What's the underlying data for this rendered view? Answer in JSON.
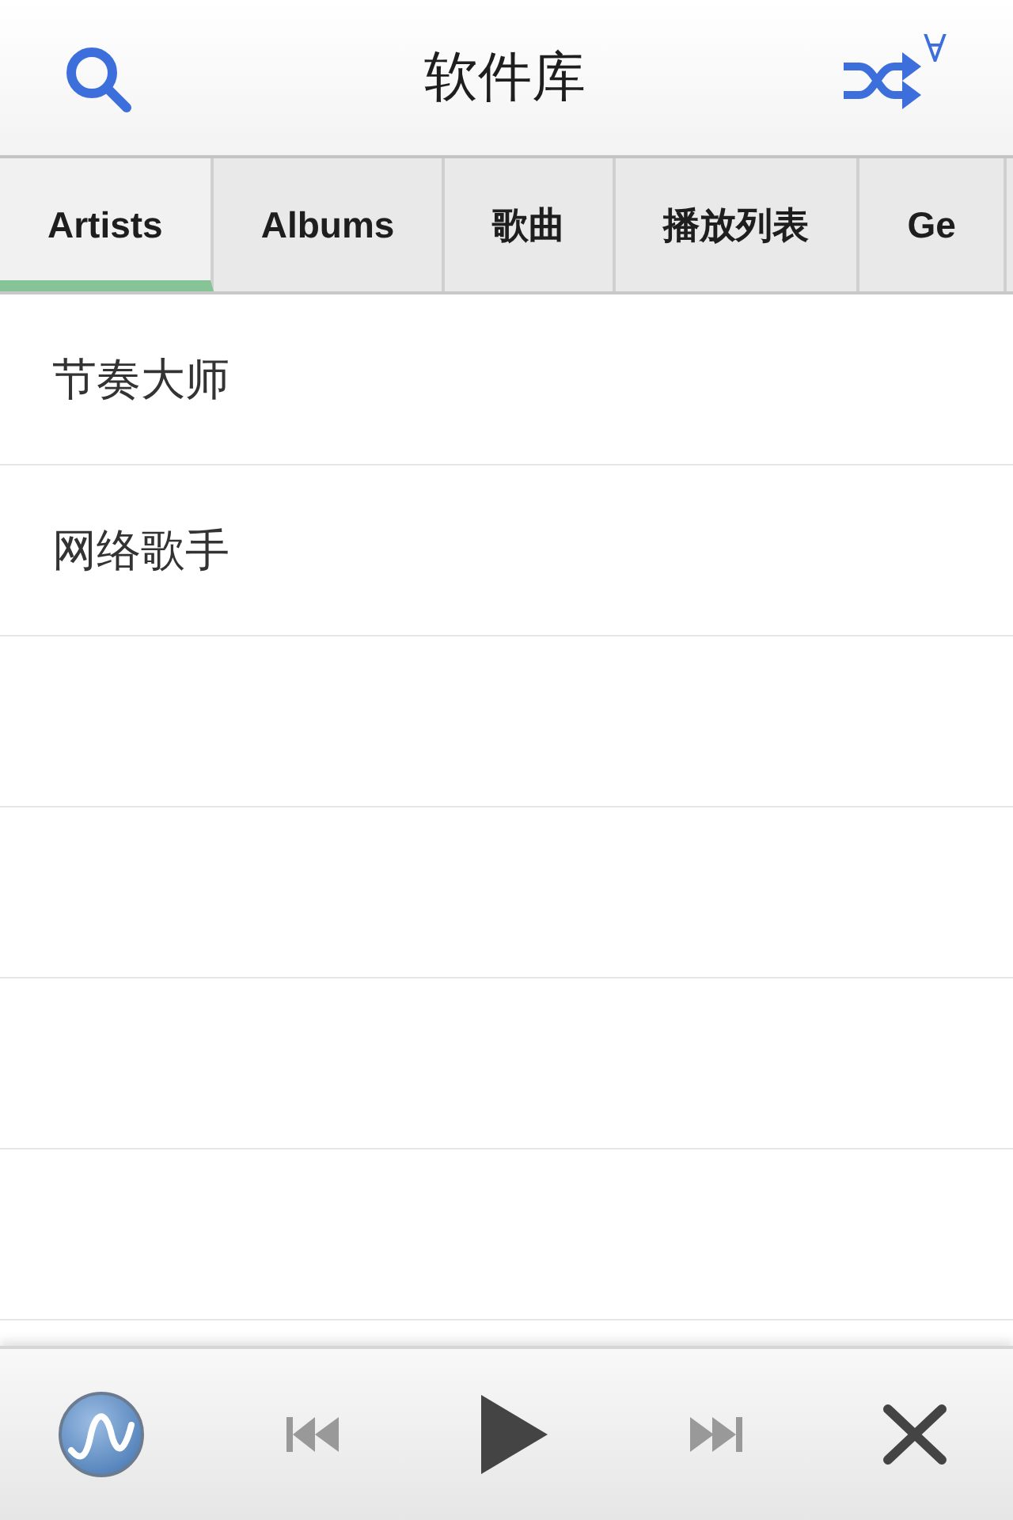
{
  "header": {
    "title": "软件库",
    "shuffle_mark": "∀"
  },
  "tabs": [
    {
      "label": "Artists",
      "selected": true
    },
    {
      "label": "Albums",
      "selected": false
    },
    {
      "label": "歌曲",
      "selected": false
    },
    {
      "label": "播放列表",
      "selected": false
    },
    {
      "label": "Ge",
      "selected": false
    }
  ],
  "list": {
    "rows": [
      {
        "label": "节奏大师"
      },
      {
        "label": "网络歌手"
      }
    ]
  },
  "player": {
    "playing": false,
    "previous": {
      "disabled": true
    },
    "next": {
      "disabled": true
    }
  }
}
